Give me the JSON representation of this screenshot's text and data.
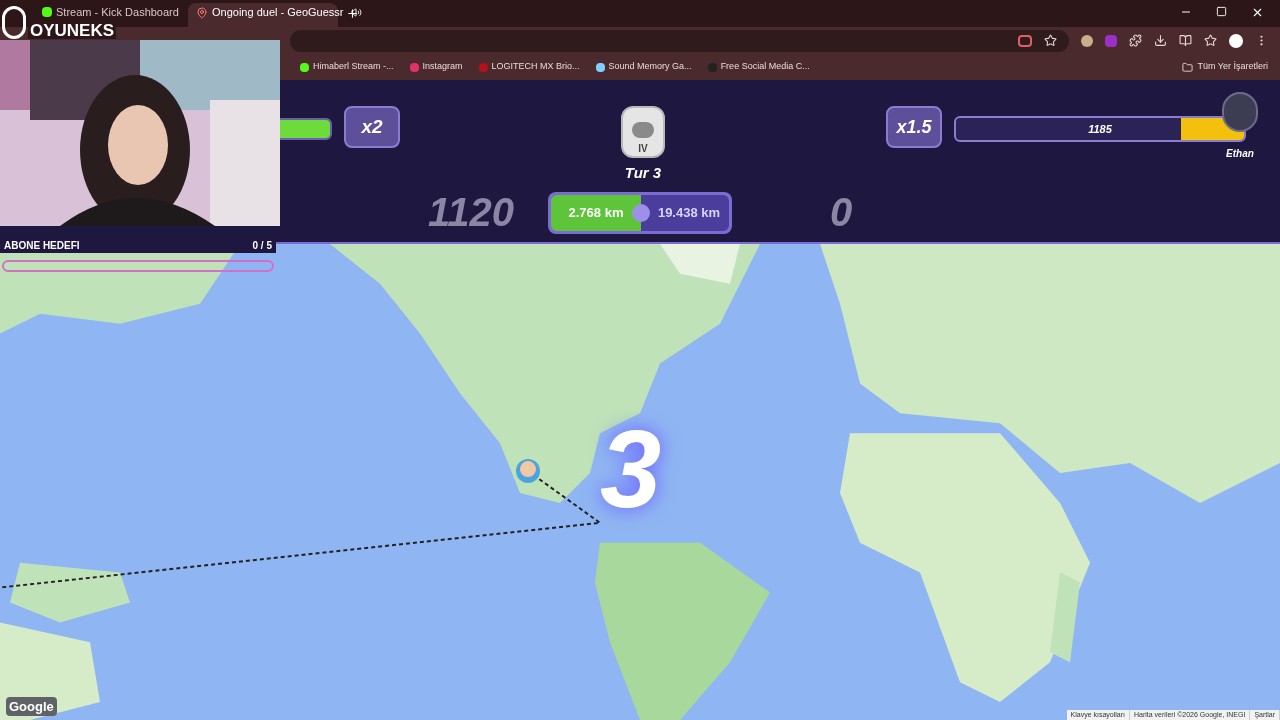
{
  "overlay": {
    "logo": "OYUNEKS",
    "goal": {
      "label": "ABONE HEDEFI",
      "count": "0 / 5",
      "level": 0
    },
    "countdown": "3"
  },
  "browser": {
    "tabs": [
      {
        "title": "Stream - Kick Dashboard",
        "selected": false,
        "audio": false
      },
      {
        "title": "Ongoing duel - GeoGuessr",
        "selected": true,
        "audio": true
      }
    ],
    "bookmarks": [
      "Himaberl Stream -...",
      "Instagram",
      "LOGITECH MX Brio...",
      "Sound Memory Ga...",
      "Free Social Media C..."
    ],
    "all_bookmarks": "Tüm Yer İşaretleri"
  },
  "game": {
    "round": "Tur 3",
    "rank": "IV",
    "left_player": {
      "multiplier": "x2",
      "level": 1,
      "score": "1120"
    },
    "right_player": {
      "multiplier": "x1.5",
      "health": "1185",
      "level": 0.22,
      "name": "Ethan",
      "score": "0"
    },
    "distance": {
      "mine": "2.768 km",
      "theirs": "19.438 km"
    }
  },
  "map": {
    "logo": "Google",
    "footer": [
      "Klavye kısayolları",
      "Harita verileri ©2026 Google, INEGI",
      "Şartlar"
    ]
  }
}
